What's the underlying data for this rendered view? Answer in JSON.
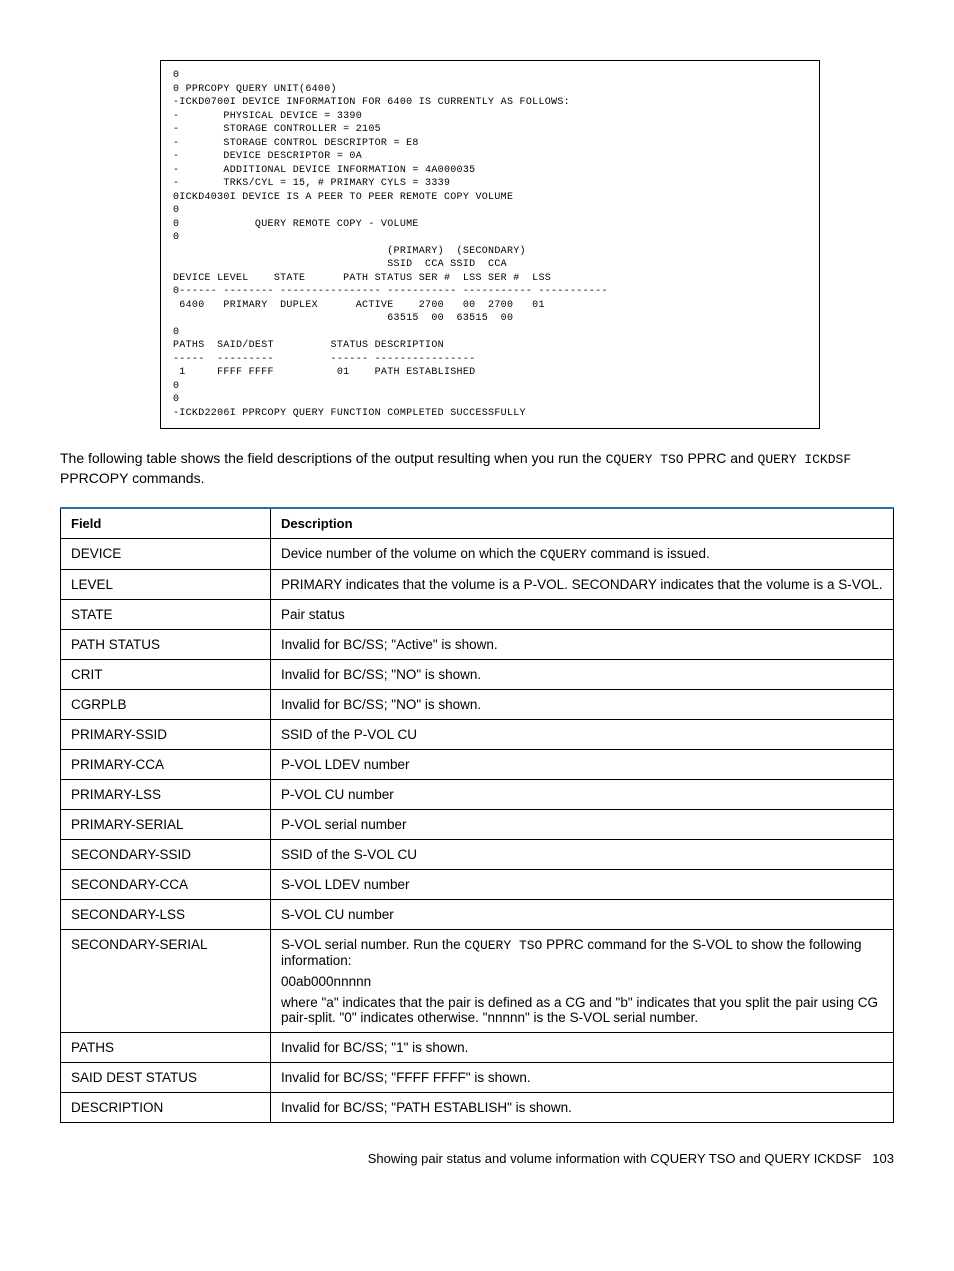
{
  "code_lines": [
    "0",
    "0 PPRCOPY QUERY UNIT(6400)",
    "-ICKD0700I DEVICE INFORMATION FOR 6400 IS CURRENTLY AS FOLLOWS:",
    "-       PHYSICAL DEVICE = 3390",
    "-       STORAGE CONTROLLER = 2105",
    "-       STORAGE CONTROL DESCRIPTOR = E8",
    "-       DEVICE DESCRIPTOR = 0A",
    "-       ADDITIONAL DEVICE INFORMATION = 4A000035",
    "-       TRKS/CYL = 15, # PRIMARY CYLS = 3339",
    "0ICKD4030I DEVICE IS A PEER TO PEER REMOTE COPY VOLUME",
    "0",
    "0            QUERY REMOTE COPY - VOLUME",
    "0",
    "                                  (PRIMARY)  (SECONDARY)",
    "                                  SSID  CCA SSID  CCA",
    "DEVICE LEVEL    STATE      PATH STATUS SER #  LSS SER #  LSS",
    "0------ -------- ---------------- ----------- ----------- -----------",
    " 6400   PRIMARY  DUPLEX      ACTIVE    2700   00  2700   01",
    "                                  63515  00  63515  00",
    "0",
    "PATHS  SAID/DEST         STATUS DESCRIPTION",
    "-----  ---------         ------ ----------------",
    " 1     FFFF FFFF          01    PATH ESTABLISHED",
    "0",
    "0",
    "-ICKD2206I PPRCOPY QUERY FUNCTION COMPLETED SUCCESSFULLY"
  ],
  "body_text": {
    "pre": "The following table shows the field descriptions of the output resulting when you run the ",
    "cquery_tso": "CQUERY TSO",
    "mid1": " PPRC and ",
    "query_ickdsf": "QUERY ICKDSF",
    "post": " PPRCOPY commands."
  },
  "table": {
    "head_field": "Field",
    "head_desc": "Description",
    "rows": [
      {
        "field": "DEVICE",
        "desc": [
          {
            "t": "Device number of the volume on which the "
          },
          {
            "m": "CQUERY"
          },
          {
            "t": " command is issued."
          }
        ]
      },
      {
        "field": "LEVEL",
        "desc": [
          {
            "t": "PRIMARY indicates that the volume is a P-VOL. SECONDARY indicates that the volume is a S-VOL."
          }
        ]
      },
      {
        "field": "STATE",
        "desc": [
          {
            "t": "Pair status"
          }
        ]
      },
      {
        "field": "PATH STATUS",
        "desc": [
          {
            "t": "Invalid for BC/SS; \"Active\" is shown."
          }
        ]
      },
      {
        "field": "CRIT",
        "desc": [
          {
            "t": "Invalid for BC/SS; \"NO\" is shown."
          }
        ]
      },
      {
        "field": "CGRPLB",
        "desc": [
          {
            "t": "Invalid for BC/SS; \"NO\" is shown."
          }
        ]
      },
      {
        "field": "PRIMARY-SSID",
        "desc": [
          {
            "t": "SSID of the P-VOL CU"
          }
        ]
      },
      {
        "field": "PRIMARY-CCA",
        "desc": [
          {
            "t": "P-VOL LDEV number"
          }
        ]
      },
      {
        "field": "PRIMARY-LSS",
        "desc": [
          {
            "t": "P-VOL CU number"
          }
        ]
      },
      {
        "field": "PRIMARY-SERIAL",
        "desc": [
          {
            "t": "P-VOL serial number"
          }
        ]
      },
      {
        "field": "SECONDARY-SSID",
        "desc": [
          {
            "t": "SSID of the S-VOL CU"
          }
        ]
      },
      {
        "field": "SECONDARY-CCA",
        "desc": [
          {
            "t": "S-VOL LDEV number"
          }
        ]
      },
      {
        "field": "SECONDARY-LSS",
        "desc": [
          {
            "t": "S-VOL CU number"
          }
        ]
      },
      {
        "field": "SECONDARY-SERIAL",
        "desc_blocks": [
          [
            {
              "t": "S-VOL serial number. Run the "
            },
            {
              "m": "CQUERY TSO"
            },
            {
              "t": " PPRC command for the S-VOL to show the following information:"
            }
          ],
          [
            {
              "t": "00ab000nnnnn"
            }
          ],
          [
            {
              "t": "where \"a\" indicates that the pair is defined as a CG and \"b\" indicates that you split the pair using CG pair-split. \"0\" indicates otherwise. \"nnnnn\" is the S-VOL serial number."
            }
          ]
        ]
      },
      {
        "field": "PATHS",
        "desc": [
          {
            "t": "Invalid for BC/SS; \"1\" is shown."
          }
        ]
      },
      {
        "field": "SAID DEST STATUS",
        "desc": [
          {
            "t": "Invalid for BC/SS; \"FFFF FFFF\" is shown."
          }
        ]
      },
      {
        "field": "DESCRIPTION",
        "desc": [
          {
            "t": "Invalid for BC/SS; \"PATH ESTABLISH\" is shown."
          }
        ]
      }
    ]
  },
  "footer": {
    "text": "Showing pair status and volume information with CQUERY TSO and QUERY ICKDSF",
    "page": "103"
  }
}
